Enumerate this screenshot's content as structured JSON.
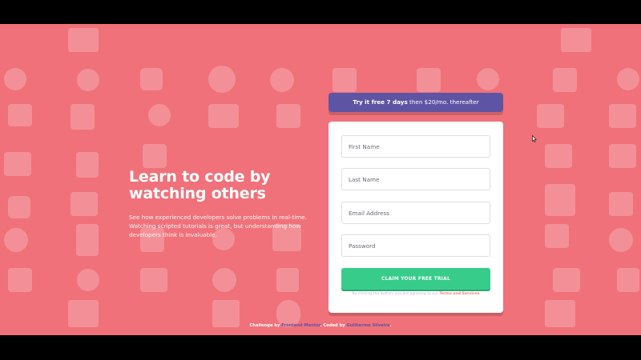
{
  "hero": {
    "title": "Learn to code by watching others",
    "description": "See how experienced developers solve problems in real-time. Watching scripted tutorials is great, but understanding how developers think is invaluable."
  },
  "promo": {
    "bold": "Try it free 7 days",
    "rest": " then $20/mo. thereafter"
  },
  "form": {
    "first_name_placeholder": "First Name",
    "last_name_placeholder": "Last Name",
    "email_placeholder": "Email Address",
    "password_placeholder": "Password",
    "submit_label": "CLAIM YOUR FREE TRIAL",
    "terms_prefix": "By clicking the button, you are agreeing to our ",
    "terms_link": "Terms and Services"
  },
  "footer": {
    "prefix": "Challenge by ",
    "link1": "Frontend Mentor",
    "middle": ". Coded by ",
    "link2": "Guilherme Silveira",
    "suffix": "."
  },
  "colors": {
    "background": "#f0717a",
    "promo": "#5e54a4",
    "cta": "#38cc8b",
    "terms_link": "#ff7a7a"
  },
  "icons": [
    "pattern-background-icons",
    "cursor-icon"
  ]
}
